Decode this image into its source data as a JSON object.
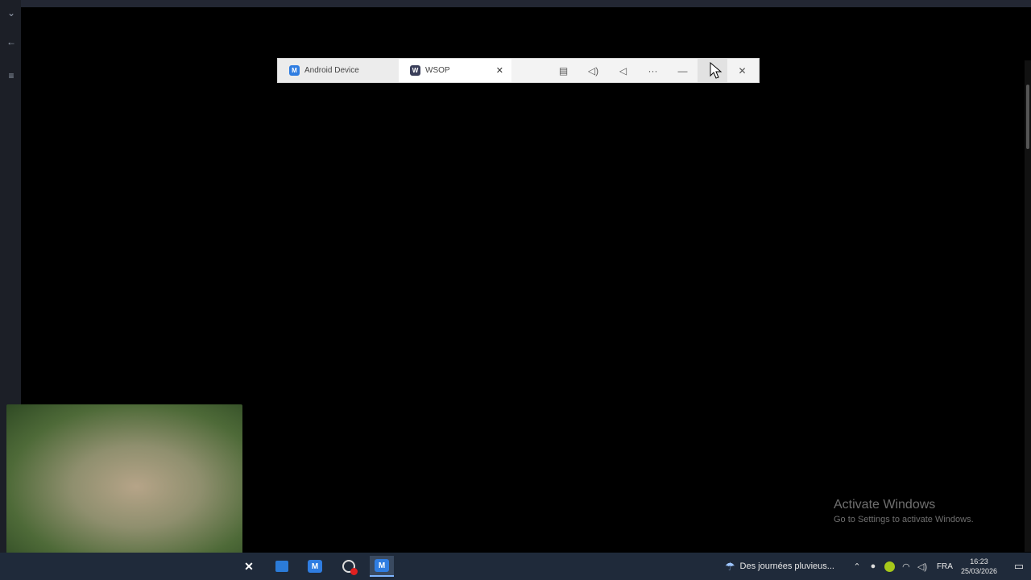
{
  "mini_window": {
    "tabs": [
      {
        "label": "Android Device",
        "icon": "android-device-app-icon",
        "active": false
      },
      {
        "label": "WSOP",
        "icon": "wsop-app-icon",
        "active": true
      }
    ],
    "tab_close_glyph": "✕",
    "toolbar": [
      {
        "name": "screenshot-icon",
        "glyph": "▤"
      },
      {
        "name": "volume-icon",
        "glyph": "◁)"
      },
      {
        "name": "back-icon",
        "glyph": "◁"
      },
      {
        "name": "more-icon",
        "glyph": "···"
      },
      {
        "name": "minimize-icon",
        "glyph": "—"
      },
      {
        "name": "maximize-icon",
        "glyph": ""
      },
      {
        "name": "close-icon",
        "glyph": "✕"
      }
    ]
  },
  "watermark": {
    "title": "Activate Windows",
    "subtitle": "Go to Settings to activate Windows."
  },
  "taskbar": {
    "weather_text": "Des journées pluvieus...",
    "language": "FRA",
    "time": "16:23",
    "date": "25/03/2026"
  },
  "colors": {
    "taskbar": "#1f2a3a",
    "accent": "#2f7de1"
  }
}
